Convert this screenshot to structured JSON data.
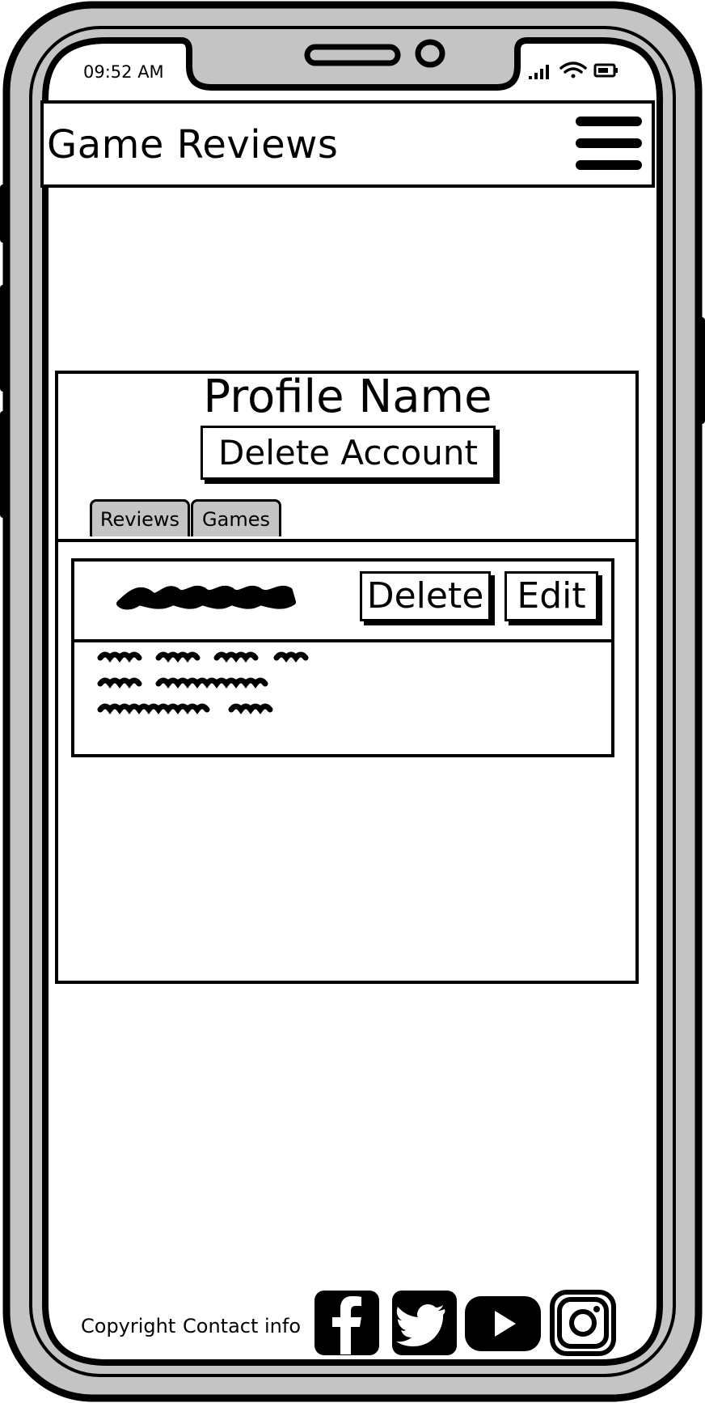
{
  "status_bar": {
    "time": "09:52 AM",
    "icons": [
      "signal-icon",
      "wifi-icon",
      "battery-icon"
    ]
  },
  "header": {
    "title": "Game Reviews",
    "menu_icon": "hamburger-menu-icon"
  },
  "profile": {
    "name": "Profile Name",
    "delete_account_label": "Delete Account"
  },
  "tabs": [
    {
      "label": "Reviews"
    },
    {
      "label": "Games"
    }
  ],
  "review_card": {
    "title_placeholder": "scribbled-title",
    "delete_label": "Delete",
    "edit_label": "Edit",
    "body_placeholder": "scribbled-text-lines"
  },
  "footer": {
    "copyright": "Copyright",
    "contact": "Contact info",
    "social_icons": [
      "facebook-icon",
      "twitter-icon",
      "youtube-icon",
      "instagram-icon"
    ]
  },
  "colors": {
    "frame_gray": "#c4c4c4",
    "ink": "#000000",
    "paper": "#ffffff"
  }
}
